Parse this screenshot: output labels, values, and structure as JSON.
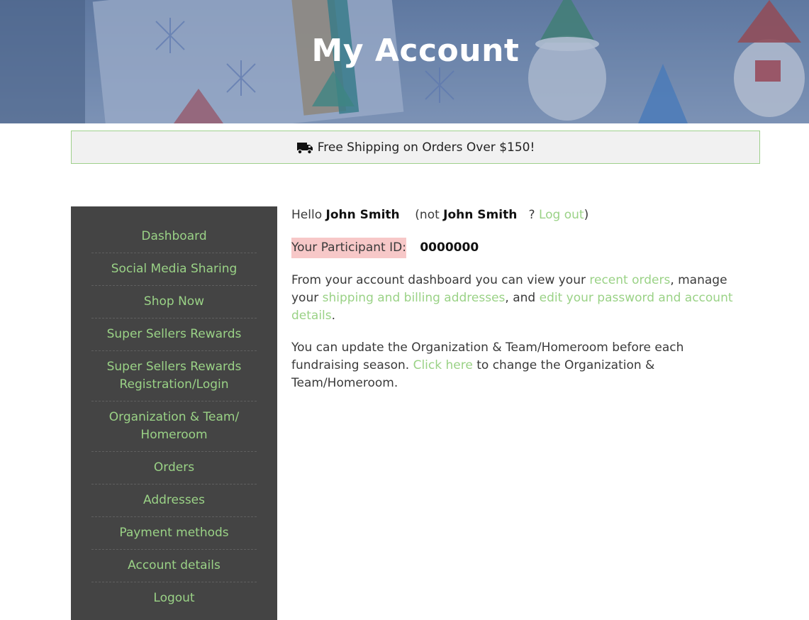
{
  "hero": {
    "title": "My Account"
  },
  "notice": {
    "text": "Free Shipping on Orders Over $150!",
    "icon": "truck-icon"
  },
  "sidebar": {
    "items": [
      {
        "label": "Dashboard"
      },
      {
        "label": "Social Media Sharing"
      },
      {
        "label": "Shop Now"
      },
      {
        "label": "Super Sellers Rewards"
      },
      {
        "label": "Super Sellers Rewards Registration/Login"
      },
      {
        "label": "Organization & Team/ Homeroom"
      },
      {
        "label": "Orders"
      },
      {
        "label": "Addresses"
      },
      {
        "label": "Payment methods"
      },
      {
        "label": "Account details"
      },
      {
        "label": "Logout"
      }
    ]
  },
  "main": {
    "hello_prefix": "Hello",
    "user_name": "John Smith",
    "not_prefix": "(not",
    "not_name": "John Smith",
    "question": "?",
    "logout_link": "Log out",
    "close_paren": ")",
    "participant_label": "Your Participant ID:",
    "participant_id": "0000000",
    "dashboard_text_1": "From your account dashboard you can view your",
    "recent_orders_link": "recent orders",
    "dashboard_text_2": ", manage your",
    "addresses_link": "shipping and billing addresses",
    "dashboard_text_3": ", and",
    "account_link": "edit your password and account details",
    "dashboard_text_4": ".",
    "org_text_1": "You can update the Organization & Team/Homeroom before each fundraising season.",
    "click_here_link": "Click here",
    "org_text_2": "to change the Organization & Team/Homeroom."
  },
  "colors": {
    "accent_green": "#9ad286",
    "sidebar_bg": "#444444",
    "pid_highlight": "#f7c8c8",
    "notice_border": "#9fd08c"
  }
}
